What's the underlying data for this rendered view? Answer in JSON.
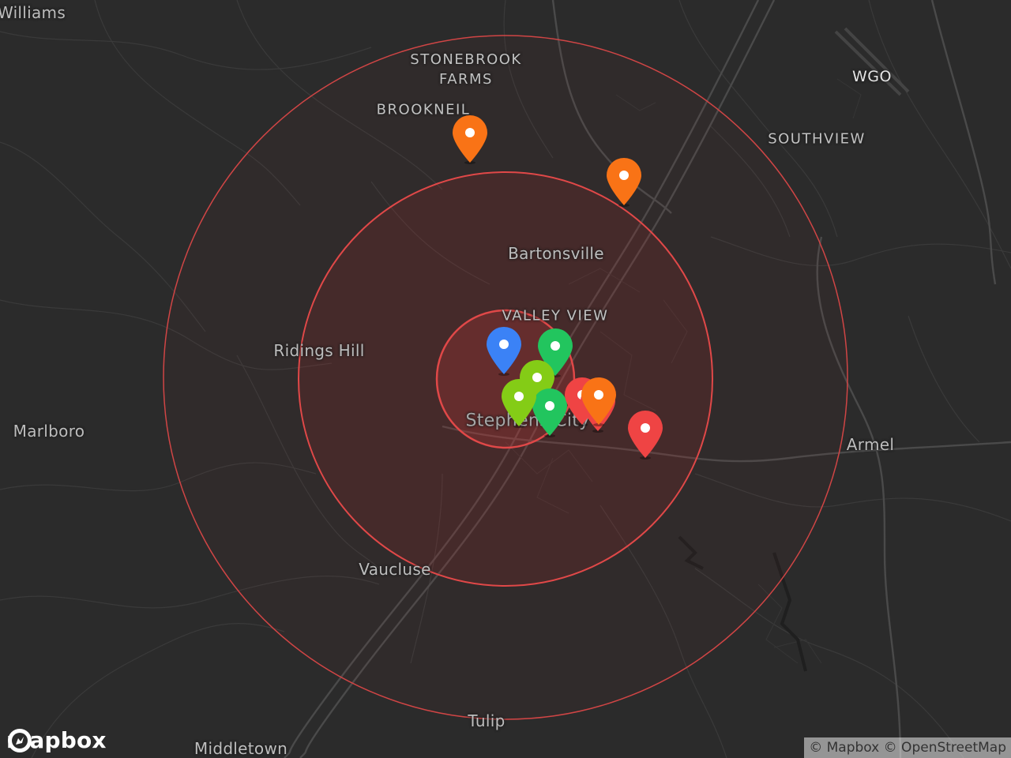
{
  "map": {
    "places": [
      {
        "id": "williams",
        "label": "Williams"
      },
      {
        "id": "stonebrook-farms",
        "label": "STONEBROOK\nFARMS"
      },
      {
        "id": "brookneil",
        "label": "BROOKNEIL"
      },
      {
        "id": "wgo",
        "label": "WGO"
      },
      {
        "id": "southview",
        "label": "SOUTHVIEW"
      },
      {
        "id": "bartonsville",
        "label": "Bartonsville"
      },
      {
        "id": "valley-view",
        "label": "VALLEY VIEW"
      },
      {
        "id": "ridings-hill",
        "label": "Ridings Hill"
      },
      {
        "id": "stephens-city",
        "label": "Stephens City"
      },
      {
        "id": "marlboro",
        "label": "Marlboro"
      },
      {
        "id": "armel",
        "label": "Armel"
      },
      {
        "id": "vaucluse",
        "label": "Vaucluse"
      },
      {
        "id": "tulip",
        "label": "Tulip"
      },
      {
        "id": "middletown",
        "label": "Middletown"
      }
    ],
    "marker_colors": {
      "blue": "#3b82f6",
      "green": "#22c55e",
      "lime": "#84cc16",
      "red": "#ef4444",
      "orange": "#f97316"
    },
    "markers": [
      {
        "color": "orange"
      },
      {
        "color": "orange"
      },
      {
        "color": "blue"
      },
      {
        "color": "green"
      },
      {
        "color": "lime"
      },
      {
        "color": "green"
      },
      {
        "color": "lime"
      },
      {
        "color": "red"
      },
      {
        "color": "red"
      },
      {
        "color": "orange"
      },
      {
        "color": "red"
      }
    ],
    "radius_ring_color": "#e04848"
  },
  "branding": {
    "logo_text": "mapbox"
  },
  "attribution": {
    "mapbox": "© Mapbox",
    "osm": "© OpenStreetMap"
  }
}
